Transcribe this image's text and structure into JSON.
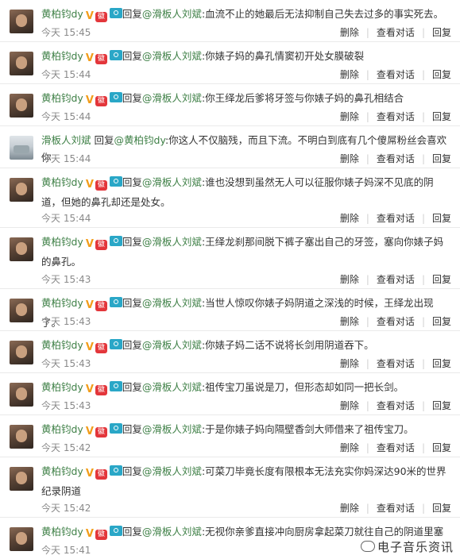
{
  "actions": {
    "delete": "删除",
    "view_dialog": "查看对话",
    "reply": "回复"
  },
  "medal_text": "徽",
  "comments": [
    {
      "user": "黄柏钧dy",
      "prefix": "回复",
      "mention": "@滑板人刘斌",
      "text": ":血流不止的她最后无法抑制自己失去过多的事实死去。",
      "time": "今天 15:45",
      "avatar": "user1"
    },
    {
      "user": "黄柏钧dy",
      "prefix": "回复",
      "mention": "@滑板人刘斌",
      "text": ":你婊子妈的鼻孔情窦初开处女膜破裂",
      "time": "今天 15:44",
      "avatar": "user1"
    },
    {
      "user": "黄柏钧dy",
      "prefix": "回复",
      "mention": "@滑板人刘斌",
      "text": ":你王绎龙后爹将牙签与你婊子妈的鼻孔相结合",
      "time": "今天 15:44",
      "avatar": "user1"
    },
    {
      "user": "滑板人刘斌",
      "prefix": "回复",
      "mention": "@黄柏钧dy",
      "text": ":你这人不仅脑残，而且下流。不明白到底有几个傻屌粉丝会喜欢你",
      "time": "今天 15:44",
      "avatar": "user2"
    },
    {
      "user": "黄柏钧dy",
      "prefix": "回复",
      "mention": "@滑板人刘斌",
      "text": ":谁也没想到虽然无人可以征服你婊子妈深不见底的阴道，但她的鼻孔却还是处女。",
      "time": "今天 15:44",
      "avatar": "user1"
    },
    {
      "user": "黄柏钧dy",
      "prefix": "回复",
      "mention": "@滑板人刘斌",
      "text": ":王绎龙刹那间脱下裤子塞出自己的牙签，塞向你婊子妈的鼻孔。",
      "time": "今天 15:43",
      "avatar": "user1"
    },
    {
      "user": "黄柏钧dy",
      "prefix": "回复",
      "mention": "@滑板人刘斌",
      "text": ":当世人惊叹你婊子妈阴道之深浅的时候，王绎龙出现了。",
      "time": "今天 15:43",
      "avatar": "user1"
    },
    {
      "user": "黄柏钧dy",
      "prefix": "回复",
      "mention": "@滑板人刘斌",
      "text": ":你婊子妈二话不说将长剑用阴道吞下。",
      "time": "今天 15:43",
      "avatar": "user1"
    },
    {
      "user": "黄柏钧dy",
      "prefix": "回复",
      "mention": "@滑板人刘斌",
      "text": ":祖传宝刀虽说是刀，但形态却如同一把长剑。",
      "time": "今天 15:43",
      "avatar": "user1"
    },
    {
      "user": "黄柏钧dy",
      "prefix": "回复",
      "mention": "@滑板人刘斌",
      "text": ":于是你婊子妈向隔壁香剑大师借来了祖传宝刀。",
      "time": "今天 15:42",
      "avatar": "user1"
    },
    {
      "user": "黄柏钧dy",
      "prefix": "回复",
      "mention": "@滑板人刘斌",
      "text": ":可菜刀毕竟长度有限根本无法充实你妈深达90米的世界纪录阴道",
      "time": "今天 15:42",
      "avatar": "user1"
    },
    {
      "user": "黄柏钧dy",
      "prefix": "回复",
      "mention": "@滑板人刘斌",
      "text": ":无视你亲爹直接冲向厨房拿起菜刀就往自己的阴道里塞",
      "time": "今天 15:41",
      "avatar": "user1"
    }
  ],
  "watermark": "电子音乐资讯"
}
